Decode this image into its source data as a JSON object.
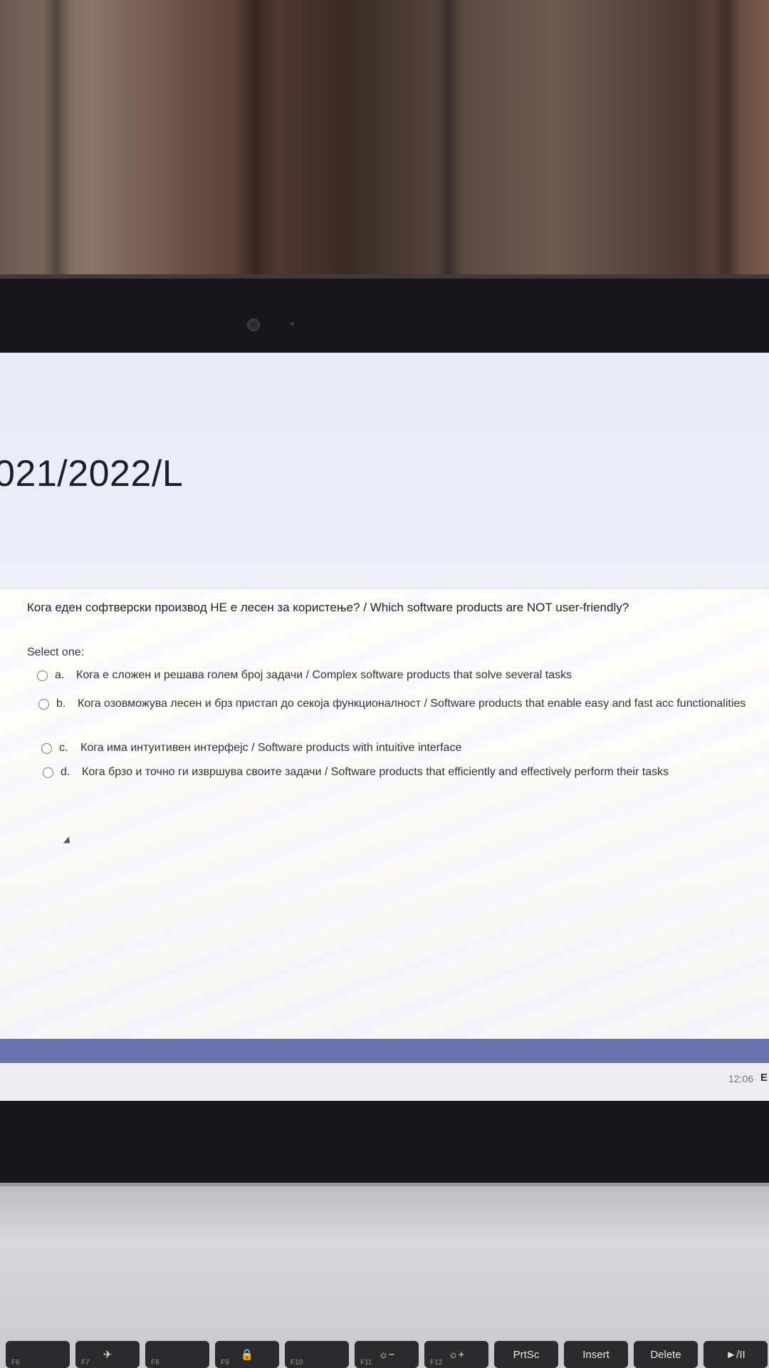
{
  "course": {
    "title": "021/2022/L"
  },
  "quiz": {
    "question": "Кога еден софтверски производ НЕ е лесен за користење? / Which software products are NOT user-friendly?",
    "select_label": "Select one:",
    "options": [
      {
        "letter": "a.",
        "text": "Кога е сложен и решава голем број задачи / Complex software products that solve several tasks"
      },
      {
        "letter": "b.",
        "text": "Кога озовможува лесен и брз пристап до секоја функционалност / Software products that enable easy and fast acc functionalities"
      },
      {
        "letter": "c.",
        "text": "Кога има интуитивен интерфејс / Software products with intuitive interface"
      },
      {
        "letter": "d.",
        "text": "Кога брзо и точно ги извршува своите задачи / Software products that efficiently and effectively perform their tasks"
      }
    ]
  },
  "taskbar": {
    "time": "12:06",
    "edge_text": "E"
  },
  "keyboard": {
    "keys": [
      {
        "label": "",
        "fn": "F6",
        "icon": "display-icon"
      },
      {
        "label": "✈",
        "fn": "F7",
        "icon": "airplane-icon"
      },
      {
        "label": "",
        "fn": "F8",
        "icon": "camera-icon"
      },
      {
        "label": "🔒",
        "fn": "F9",
        "icon": "lock-icon"
      },
      {
        "label": "",
        "fn": "F10",
        "icon": "dual-display-icon"
      },
      {
        "label": "☼−",
        "fn": "F11",
        "icon": "brightness-down-icon"
      },
      {
        "label": "☼+",
        "fn": "F12",
        "icon": "brightness-up-icon"
      },
      {
        "label": "PrtSc",
        "fn": ""
      },
      {
        "label": "Insert",
        "fn": ""
      },
      {
        "label": "Delete",
        "fn": ""
      },
      {
        "label": "►/II",
        "fn": ""
      }
    ]
  }
}
